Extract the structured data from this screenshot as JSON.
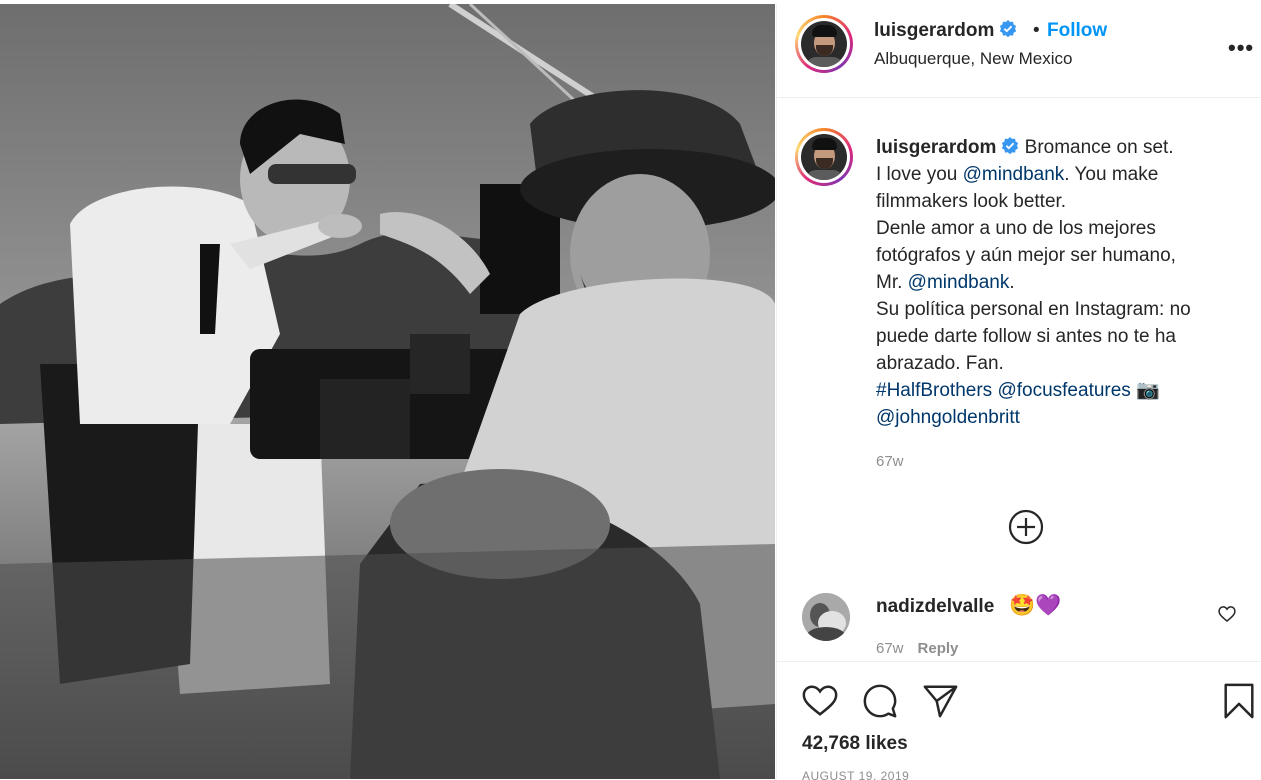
{
  "post": {
    "photo_alt": "Black and white on-set photo: man in sunglasses pointing next to a camera operator in a hat"
  },
  "header": {
    "username": "luisgerardom",
    "separator": "•",
    "follow_label": "Follow",
    "location": "Albuquerque, New Mexico",
    "more_label": "•••"
  },
  "caption": {
    "username": "luisgerardom",
    "line1_text": "Bromance on set.",
    "line2_pre": "I love you ",
    "line2_mention": "@mindbank",
    "line2_post": ". You make",
    "line3": "filmmakers look better.",
    "line4": "Denle amor a uno de los mejores",
    "line5": "fotógrafos y aún mejor ser humano,",
    "line6_pre": "Mr. ",
    "line6_mention": "@mindbank",
    "line6_post": ".",
    "line7": "Su política personal en Instagram: no",
    "line8": "puede darte follow si antes no te ha",
    "line9": "abrazado. Fan.",
    "hashtag": "#HalfBrothers",
    "mention_focus": "@focusfeatures",
    "camera_emoji": "📷",
    "mention_john": "@johngoldenbritt",
    "time": "67w"
  },
  "comment": {
    "username": "nadizdelvalle",
    "emojis": "🤩💜",
    "time": "67w",
    "reply_label": "Reply"
  },
  "actions": {
    "likes": "42,768 likes",
    "date": "AUGUST 19, 2019"
  },
  "colors": {
    "link": "#00376b",
    "follow": "#0095f6",
    "verified": "#3897f0",
    "secondary_text": "#8e8e8e"
  }
}
